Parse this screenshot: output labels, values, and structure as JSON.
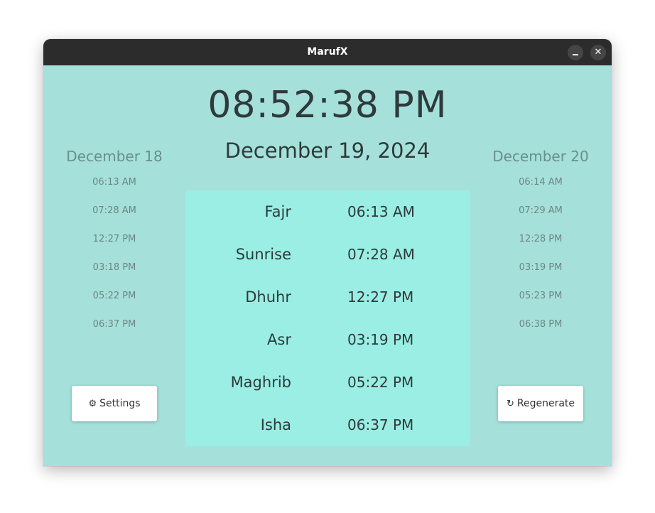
{
  "window": {
    "title": "MarufX",
    "minimize_icon": "minimize-icon",
    "close_icon": "close-icon",
    "close_glyph": "✕"
  },
  "clock": {
    "time": "08:52:38 PM",
    "date": "December 19, 2024"
  },
  "previous_day": {
    "date": "December 18",
    "times": [
      "06:13 AM",
      "07:28 AM",
      "12:27 PM",
      "03:18 PM",
      "05:22 PM",
      "06:37 PM"
    ]
  },
  "next_day": {
    "date": "December 20",
    "times": [
      "06:14 AM",
      "07:29 AM",
      "12:28 PM",
      "03:19 PM",
      "05:23 PM",
      "06:38 PM"
    ]
  },
  "prayers": [
    {
      "name": "Fajr",
      "time": "06:13 AM"
    },
    {
      "name": "Sunrise",
      "time": "07:28 AM"
    },
    {
      "name": "Dhuhr",
      "time": "12:27 PM"
    },
    {
      "name": "Asr",
      "time": "03:19 PM"
    },
    {
      "name": "Maghrib",
      "time": "05:22 PM"
    },
    {
      "name": "Isha",
      "time": "06:37 PM"
    }
  ],
  "buttons": {
    "settings_label": "Settings",
    "settings_icon": "⚙",
    "settings_icon_name": "gear-icon",
    "regenerate_label": "Regenerate",
    "regenerate_icon": "↻",
    "regenerate_icon_name": "refresh-icon"
  },
  "colors": {
    "titlebar": "#2c2c2c",
    "background": "#a5e0da",
    "panel": "#9aeee4",
    "text": "#2f3a3a",
    "muted_text": "#6a8f8b"
  }
}
